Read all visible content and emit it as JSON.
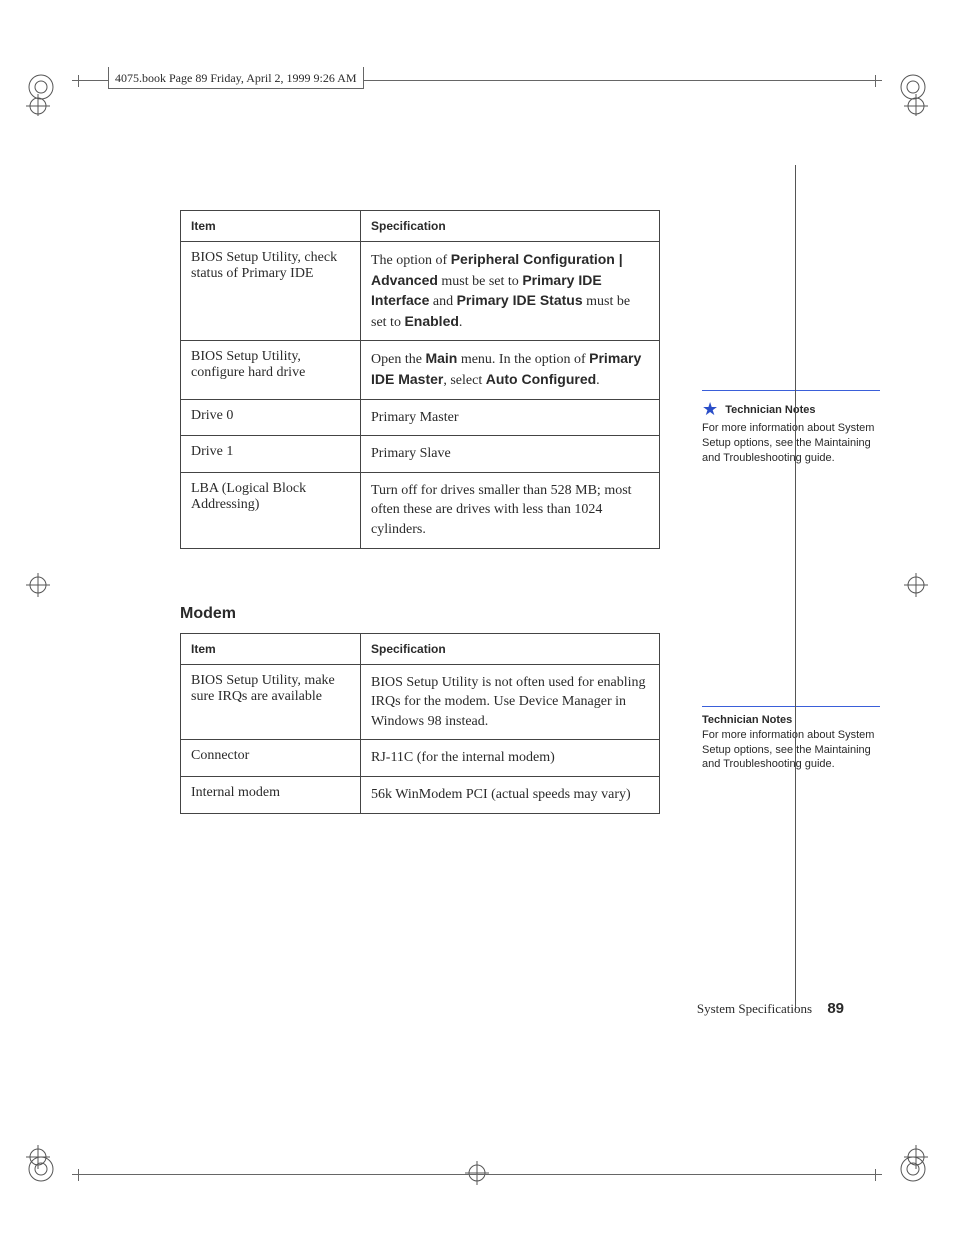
{
  "header_caption": "4075.book  Page 89  Friday, April 2, 1999  9:26 AM",
  "table1": {
    "head_item": "Item",
    "head_spec": "Specification",
    "rows": [
      {
        "label": "BIOS Setup Utility, check status of Primary IDE",
        "value": "The option of <b>Peripheral Configuration | Advanced</b> must be set to <b>Primary IDE Interface</b> and <b>Primary IDE Status</b> must be set to <b>Enabled</b>."
      },
      {
        "label": "BIOS Setup Utility, configure hard drive",
        "value": "Open the <b>Main</b> menu. In the option of <b>Primary IDE Master</b>, select <b>Auto Configured</b>."
      },
      {
        "label": "Drive 0",
        "value": "Primary Master"
      },
      {
        "label": "Drive 1",
        "value": "Primary Slave"
      },
      {
        "label": "LBA (Logical Block Addressing)",
        "value": "Turn off for drives smaller than 528 MB; most often these are drives with less than 1024 cylinders."
      }
    ]
  },
  "modem_heading": "Modem",
  "table2": {
    "head_item": "Item",
    "head_spec": "Specification",
    "rows": [
      {
        "label": "BIOS Setup Utility, make sure IRQs are available",
        "value": "BIOS Setup Utility is not often used for enabling IRQs for the modem. Use Device Manager in Windows 98 instead."
      },
      {
        "label": "Connector",
        "value": "RJ-11C (for the internal modem)"
      },
      {
        "label": "Internal modem",
        "value": "56k WinModem PCI (actual speeds may vary)"
      }
    ]
  },
  "sidebar": {
    "block1": {
      "title": "Technician Notes",
      "body": "For more information about System Setup options, see the Maintaining and Troubleshooting guide."
    },
    "block2": {
      "title": "Technician Notes",
      "body": "For more information about System Setup options, see the Maintaining and Troubleshooting guide."
    }
  },
  "footer": {
    "label": "System Specifications",
    "page": "89"
  }
}
